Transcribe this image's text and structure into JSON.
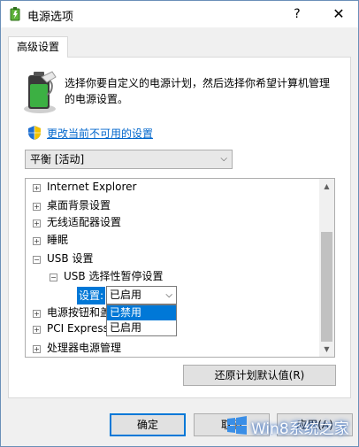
{
  "window": {
    "title": "电源选项",
    "help": "?",
    "close": "✕"
  },
  "tab": {
    "label": "高级设置"
  },
  "description": "选择你要自定义的电源计划，然后选择你希望计算机管理的电源设置。",
  "link": {
    "text": "更改当前不可用的设置"
  },
  "plan_select": {
    "value": "平衡 [活动]",
    "arrow": "⌵"
  },
  "tree": {
    "items": [
      {
        "expander": "+",
        "label": "Internet Explorer"
      },
      {
        "expander": "+",
        "label": "桌面背景设置"
      },
      {
        "expander": "+",
        "label": "无线适配器设置"
      },
      {
        "expander": "+",
        "label": "睡眠"
      },
      {
        "expander": "−",
        "label": "USB 设置"
      },
      {
        "expander": "−",
        "label": "USB 选择性暂停设置"
      },
      {
        "expander": "+",
        "label": "电源按钮和盖"
      },
      {
        "expander": "+",
        "label": "PCI Express"
      },
      {
        "expander": "+",
        "label": "处理器电源管理"
      }
    ],
    "setting_label": "设置:",
    "value": "已启用",
    "options": [
      "已禁用",
      "已启用"
    ],
    "selected_option": "已禁用"
  },
  "scrollbar": {
    "up": "▲",
    "down": "▼"
  },
  "buttons": {
    "restore": "还原计划默认值(R)",
    "ok": "确定",
    "cancel": "取消",
    "apply": "应用(A)"
  },
  "watermark": {
    "text": "Win8系统之家"
  },
  "colors": {
    "accent": "#0078d7",
    "link": "#0066cc",
    "battery": "#3cb043"
  }
}
